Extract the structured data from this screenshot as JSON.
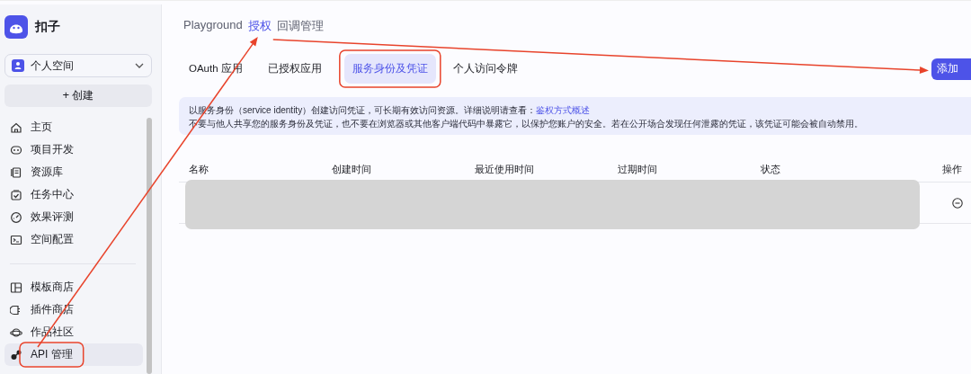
{
  "sidebar": {
    "brand": "扣子",
    "workspace": "个人空间",
    "create_icon": "+",
    "create_button": "创建",
    "nav_items": [
      {
        "label": "主页",
        "selected": false
      },
      {
        "label": "项目开发",
        "selected": false
      },
      {
        "label": "资源库",
        "selected": false
      },
      {
        "label": "任务中心",
        "selected": false
      },
      {
        "label": "效果评测",
        "selected": false
      },
      {
        "label": "空间配置",
        "selected": false
      }
    ],
    "tool_items": [
      {
        "label": "模板商店",
        "selected": false
      },
      {
        "label": "插件商店",
        "selected": false
      },
      {
        "label": "作品社区",
        "selected": false
      },
      {
        "label": "API 管理",
        "selected": true
      }
    ]
  },
  "top_tabs": [
    {
      "label": "Playground",
      "selected": false
    },
    {
      "label": "授权",
      "selected": true
    },
    {
      "label": "回调管理",
      "selected": false
    }
  ],
  "sub_tabs": [
    {
      "label": "OAuth 应用",
      "selected": false
    },
    {
      "label": "已授权应用",
      "selected": false
    },
    {
      "label": "服务身份及凭证",
      "selected": true
    },
    {
      "label": "个人访问令牌",
      "selected": false
    }
  ],
  "add_button": "添加",
  "notice": {
    "text": "以服务身份（service identity）创建访问凭证，可长期有效访问资源。详细说明请查看：",
    "link": "鉴权方式概述",
    "warning": "不要与他人共享您的服务身份及凭证，也不要在浏览器或其他客户端代码中暴露它，以保护您账户的安全。若在公开场合发现任何泄露的凭证，该凭证可能会被自动禁用。"
  },
  "table": {
    "columns": [
      "名称",
      "创建时间",
      "最近使用时间",
      "过期时间",
      "状态",
      "操作"
    ],
    "rows": [
      {
        "kind": "redacted"
      }
    ]
  },
  "annotations": [
    {
      "kind": "arrow"
    },
    {
      "kind": "arrow"
    },
    {
      "kind": "box"
    },
    {
      "kind": "box"
    }
  ]
}
